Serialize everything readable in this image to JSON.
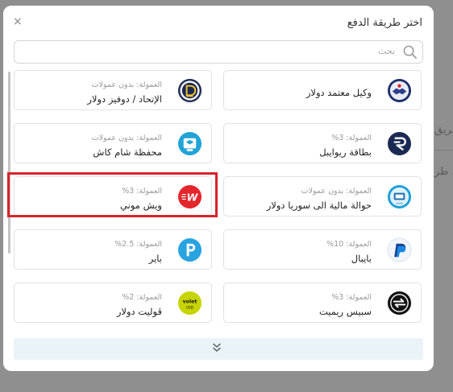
{
  "modal": {
    "title": "اختر طريقة الدفع",
    "close_glyph": "×"
  },
  "search": {
    "placeholder": "بحث"
  },
  "background": {
    "text_1": "طريق",
    "text_2": "د طر"
  },
  "methods": [
    {
      "name": "وكيل معتمد دولار",
      "fee": ""
    },
    {
      "name": "الإتحاد / دوفيز دولار",
      "fee": "العمولة: بدون عمولات"
    },
    {
      "name": "بطاقة ريوايبل",
      "fee": "العمولة: 3%"
    },
    {
      "name": "محفظة شام كاش",
      "fee": "العمولة: بدون عمولات"
    },
    {
      "name": "حوالة مالية الى سوريا دولار",
      "fee": "العمولة: بدون عمولات"
    },
    {
      "name": "ويش موني",
      "fee": "العمولة: 3%"
    },
    {
      "name": "بايبال",
      "fee": "العمولة: 10%"
    },
    {
      "name": "باير",
      "fee": "العمولة: 2.5%"
    },
    {
      "name": "سبيس ريميت",
      "fee": "العمولة: 3%"
    },
    {
      "name": "ڤوليت دولار",
      "fee": "العمولة: 2%"
    }
  ],
  "colors": {
    "highlight": "#d8232a",
    "navy": "#1b2a52",
    "paypal_blue": "#1a88e0",
    "volet_green": "#c8d400"
  },
  "icons": {
    "close": "close-icon",
    "search": "search-icon",
    "expand": "double-chevron-down-icon"
  }
}
